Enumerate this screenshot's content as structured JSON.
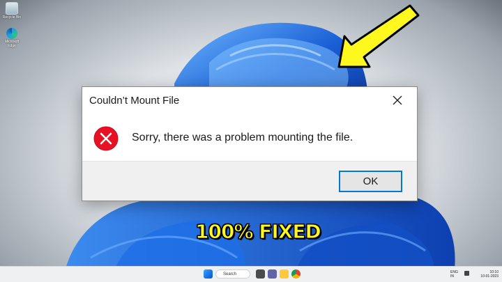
{
  "dialog": {
    "title": "Couldn’t Mount File",
    "message": "Sorry, there was a problem mounting the file.",
    "ok_label": "OK"
  },
  "overlay": {
    "caption": "100% FIXED",
    "caption_color": "#fff81f",
    "arrow_color": "#fff81f"
  },
  "desktop": {
    "icons": [
      {
        "label": "Recycle Bin",
        "icon": "recycle-bin-icon"
      },
      {
        "label": "Microsoft Edge",
        "icon": "edge-icon"
      }
    ]
  },
  "taskbar": {
    "search_label": "Search",
    "tray_lang_top": "ENG",
    "tray_lang_bottom": "IN",
    "clock_time": "10:10",
    "clock_date": "10-01-2023"
  },
  "colors": {
    "error_red": "#e81123",
    "accent": "#0078d4",
    "wallpaper_blue": "#1a5fd6"
  }
}
